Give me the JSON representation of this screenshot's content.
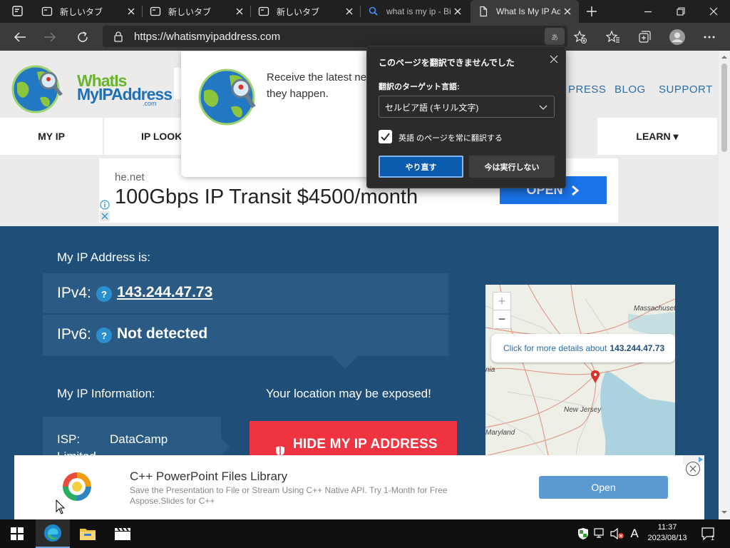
{
  "browser": {
    "tabs": [
      {
        "title": "新しいタブ",
        "favicon": "browser-tab-icon"
      },
      {
        "title": "新しいタブ",
        "favicon": "browser-tab-icon"
      },
      {
        "title": "新しいタブ",
        "favicon": "browser-tab-icon"
      },
      {
        "title": "what is my ip - Bing",
        "favicon": "search-icon"
      },
      {
        "title": "What Is My IP Address",
        "favicon": "document-icon"
      }
    ],
    "address": "https://whatismyipaddress.com",
    "translate_icon": "あ"
  },
  "site": {
    "logo_line1": "WhatIs",
    "logo_line2": "MyIPAddress",
    "logo_line3": ".com",
    "header_links": [
      "PRESS",
      "BLOG",
      "SUPPORT"
    ],
    "nav": [
      "MY IP",
      "IP LOOK",
      "LEARN ▾"
    ]
  },
  "ad_top": {
    "domain": "he.net",
    "headline": "100Gbps IP Transit $4500/month",
    "cta": "OPEN"
  },
  "ip": {
    "title": "My IP Address is:",
    "ipv4_label": "IPv4:",
    "ipv4_value": "143.244.47.73",
    "ipv6_label": "IPv6:",
    "ipv6_value": "Not detected",
    "help": "?",
    "info_title": "My IP Information:",
    "isp_label": "ISP:",
    "isp_value": "DataCamp",
    "isp_value2": "Limited",
    "exposed": "Your location may be exposed!",
    "hide_button": "HIDE MY IP ADDRESS"
  },
  "map": {
    "popup_text": "Click for more details about",
    "popup_ip": "143.244.47.73",
    "labels": [
      "Massachusetts",
      "New Jersey",
      "Maryland",
      "nia"
    ],
    "zoom_in": "+",
    "zoom_out": "−"
  },
  "notify": {
    "text_line1": "Receive the latest ne",
    "text_line2": "they happen."
  },
  "translate_popup": {
    "title": "このページを翻訳できませんでした",
    "target_label": "翻訳のターゲット言語:",
    "target_value": "セルビア語 (キリル文字)",
    "always_translate": "英語 のページを常に翻訳する",
    "always_checked": true,
    "retry": "やり直す",
    "not_now": "今は実行しない"
  },
  "ad_bottom": {
    "title": "C++ PowerPoint Files Library",
    "desc": "Save the Presentation to File or Stream Using C++ Native API. Try 1-Month for Free Aspose.Slides for C++",
    "cta": "Open"
  },
  "taskbar": {
    "time": "11:37",
    "date": "2023/08/13",
    "ime": "A",
    "notification_count": "1"
  },
  "colors": {
    "brand_blue": "#1f4e78",
    "hide_red": "#ef3340",
    "edge_dark": "#202020"
  }
}
